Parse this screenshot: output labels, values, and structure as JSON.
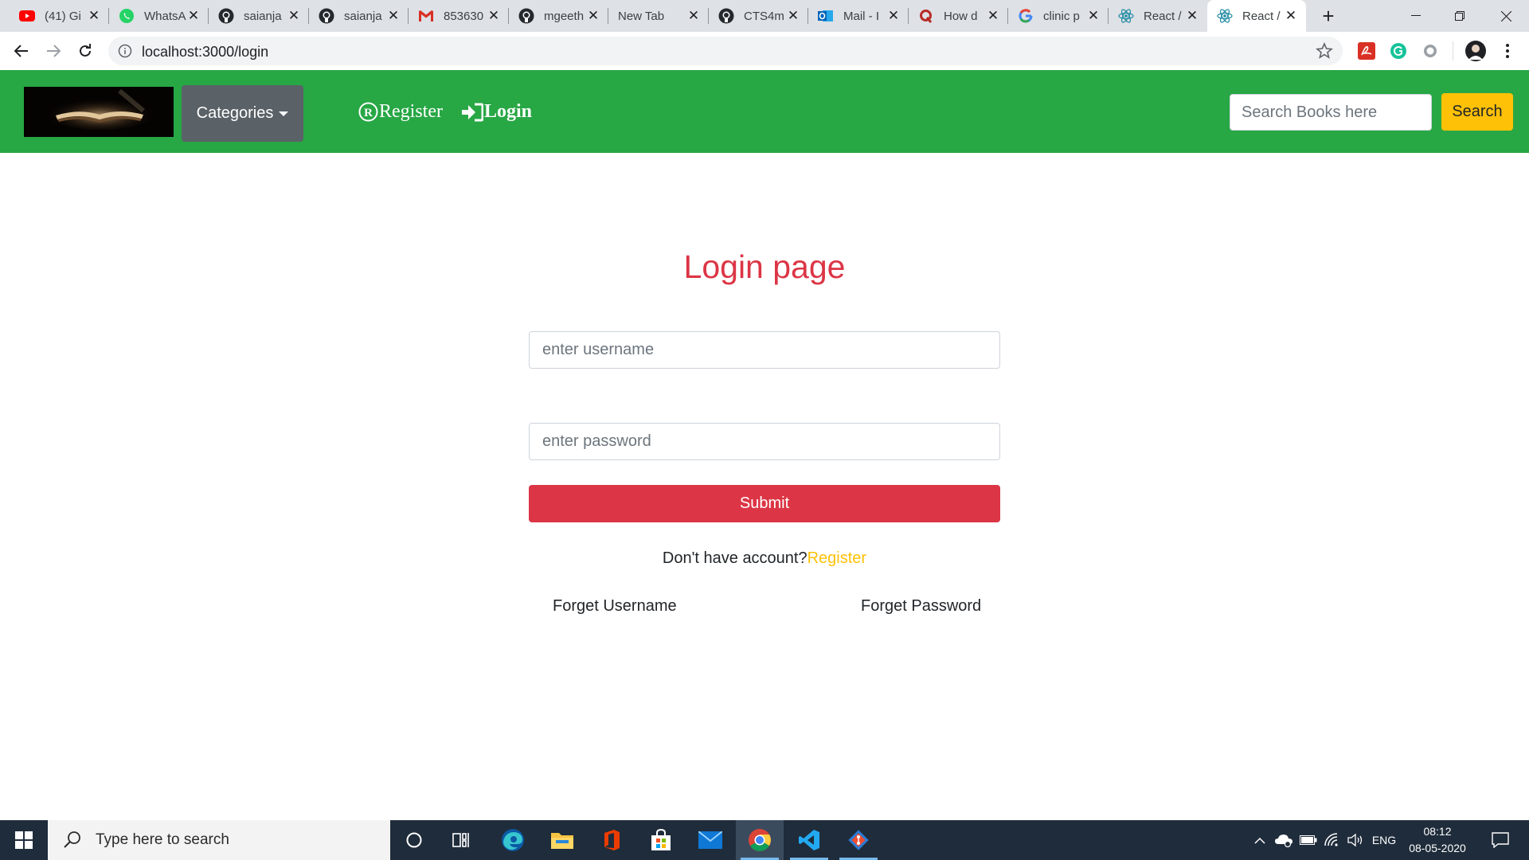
{
  "browser": {
    "tabs": [
      {
        "title": "(41) Gi",
        "favicon": "youtube-icon"
      },
      {
        "title": "WhatsA",
        "favicon": "whatsapp-icon"
      },
      {
        "title": "saianja",
        "favicon": "github-icon"
      },
      {
        "title": "saianja",
        "favicon": "github-icon"
      },
      {
        "title": "853630",
        "favicon": "gmail-icon"
      },
      {
        "title": "mgeeth",
        "favicon": "github-icon"
      },
      {
        "title": "New Tab",
        "favicon": ""
      },
      {
        "title": "CTS4m",
        "favicon": "github-icon"
      },
      {
        "title": "Mail - I",
        "favicon": "outlook-icon"
      },
      {
        "title": "How d",
        "favicon": "quora-icon"
      },
      {
        "title": "clinic p",
        "favicon": "google-icon"
      },
      {
        "title": "React /",
        "favicon": "react-icon"
      },
      {
        "title": "React /",
        "favicon": "react-icon",
        "active": true
      }
    ],
    "url": "localhost:3000/login"
  },
  "navbar": {
    "categories_label": "Categories",
    "register_label": "Register",
    "login_label": "Login",
    "search_placeholder": "Search Books here",
    "search_button": "Search",
    "colors": {
      "navbar_bg": "#28a745",
      "categories_bg": "#5a6268",
      "search_btn_bg": "#ffc107"
    }
  },
  "login": {
    "title": "Login page",
    "username_placeholder": "enter username",
    "password_placeholder": "enter password",
    "submit_label": "Submit",
    "no_account_text": "Don't have account?",
    "register_link": "Register",
    "forget_username": "Forget Username",
    "forget_password": "Forget Password",
    "colors": {
      "title": "#dc3545",
      "submit_bg": "#dc3545",
      "register_link": "#ffc107"
    }
  },
  "taskbar": {
    "search_text": "Type here to search",
    "apps": [
      "cortana-icon",
      "task-view-icon",
      "edge-icon",
      "file-explorer-icon",
      "office-icon",
      "store-icon",
      "mail-icon",
      "chrome-icon",
      "vscode-icon",
      "git-icon"
    ],
    "language": "ENG",
    "time": "08:12",
    "date": "08-05-2020"
  }
}
